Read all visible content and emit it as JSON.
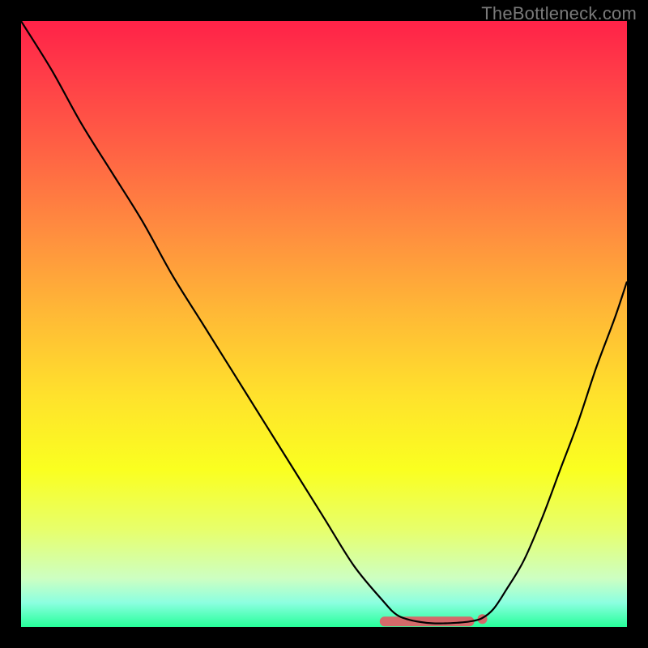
{
  "watermark": "TheBottleneck.com",
  "chart_data": {
    "type": "line",
    "title": "",
    "xlabel": "",
    "ylabel": "",
    "xlim": [
      0,
      100
    ],
    "ylim": [
      0,
      100
    ],
    "grid": false,
    "legend": false,
    "series": [
      {
        "name": "bottleneck-curve",
        "color": "#000000",
        "x": [
          0,
          5,
          10,
          15,
          20,
          25,
          30,
          35,
          40,
          45,
          50,
          55,
          60,
          62,
          64,
          66,
          68,
          70,
          72,
          74,
          76,
          78,
          80,
          83,
          86,
          89,
          92,
          95,
          98,
          100
        ],
        "y": [
          100,
          92,
          83,
          75,
          67,
          58,
          50,
          42,
          34,
          26,
          18,
          10,
          4,
          2,
          1.2,
          0.8,
          0.6,
          0.6,
          0.7,
          0.9,
          1.4,
          3,
          6,
          11,
          18,
          26,
          34,
          43,
          51,
          57
        ]
      },
      {
        "name": "optimal-zone",
        "color": "#d46a6a",
        "type": "marker-band",
        "x_start": 60,
        "x_end": 74,
        "y": 0.9
      }
    ],
    "background_gradient": {
      "stops": [
        {
          "pos": 0,
          "color": "#ff2248"
        },
        {
          "pos": 8,
          "color": "#ff3a48"
        },
        {
          "pos": 22,
          "color": "#ff6444"
        },
        {
          "pos": 35,
          "color": "#ff8e3f"
        },
        {
          "pos": 48,
          "color": "#ffb836"
        },
        {
          "pos": 62,
          "color": "#ffe22c"
        },
        {
          "pos": 74,
          "color": "#faff20"
        },
        {
          "pos": 84,
          "color": "#e7ff6c"
        },
        {
          "pos": 92,
          "color": "#cdffc2"
        },
        {
          "pos": 96,
          "color": "#8cffe0"
        },
        {
          "pos": 100,
          "color": "#26ff9a"
        }
      ]
    }
  }
}
